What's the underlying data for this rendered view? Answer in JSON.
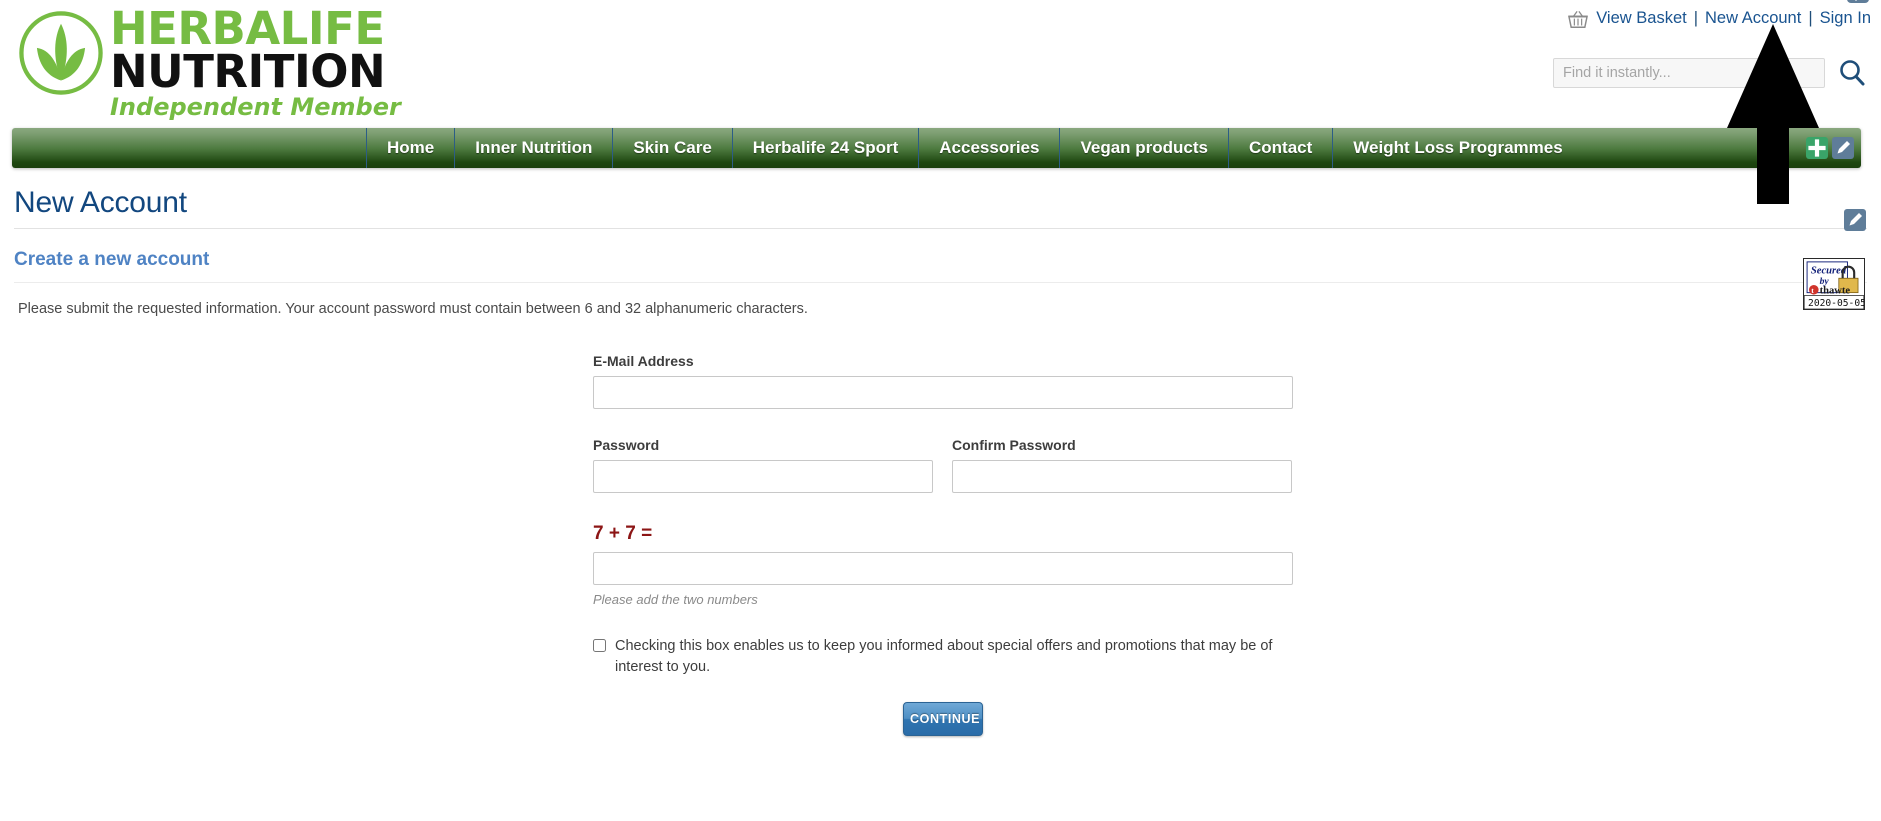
{
  "brand": {
    "logo_line1": "HERBALIFE",
    "logo_line2": "NUTRITION",
    "logo_line3": "Independent Member",
    "green": "#76bc43",
    "black": "#111111"
  },
  "header": {
    "basket_icon": "basket-icon",
    "view_basket": "View Basket",
    "separator": "|",
    "new_account": "New Account",
    "sign_in": "Sign In",
    "search_icon": "search-icon",
    "corner_icon": "pencil-edit-icon"
  },
  "search": {
    "placeholder": "Find it instantly...",
    "value": ""
  },
  "nav": {
    "items": [
      {
        "label": "Home"
      },
      {
        "label": "Inner Nutrition"
      },
      {
        "label": "Skin Care"
      },
      {
        "label": "Herbalife 24 Sport"
      },
      {
        "label": "Accessories"
      },
      {
        "label": "Vegan products"
      },
      {
        "label": "Contact"
      },
      {
        "label": "Weight Loss Programmes"
      }
    ],
    "add_icon": "plus-icon",
    "edit_icon": "pencil-icon",
    "gradient_top": "#8aa87f",
    "gradient_bottom": "#1b400e"
  },
  "main": {
    "page_title": "New Account",
    "page_title_color": "#12477f",
    "section_title": "Create a new account",
    "section_title_color": "#4f83c4",
    "intro": "Please submit the requested information. Your account password must contain between 6 and 32 alphanumeric characters.",
    "edit_icon": "pencil-edit-icon"
  },
  "badge": {
    "line1": "Secured",
    "line2": "by",
    "line3": "thawte",
    "mark": "t",
    "date": "2020-05-05"
  },
  "form": {
    "email_label": "E-Mail Address",
    "email_value": "",
    "password_label": "Password",
    "password_value": "",
    "confirm_label": "Confirm Password",
    "confirm_value": "",
    "captcha_question": "7 + 7 =",
    "captcha_value": "",
    "captcha_hint": "Please add the two numbers",
    "captcha_color": "#8c1515",
    "newsletter_label": "Checking this box enables us to keep you informed about special offers and promotions that may be of interest to you.",
    "newsletter_checked": false,
    "continue_label": "CONTINUE",
    "continue_color": "#2f74b0"
  },
  "annotation": {
    "arrow": "up-arrow-pointer",
    "points_at": "New Account"
  }
}
